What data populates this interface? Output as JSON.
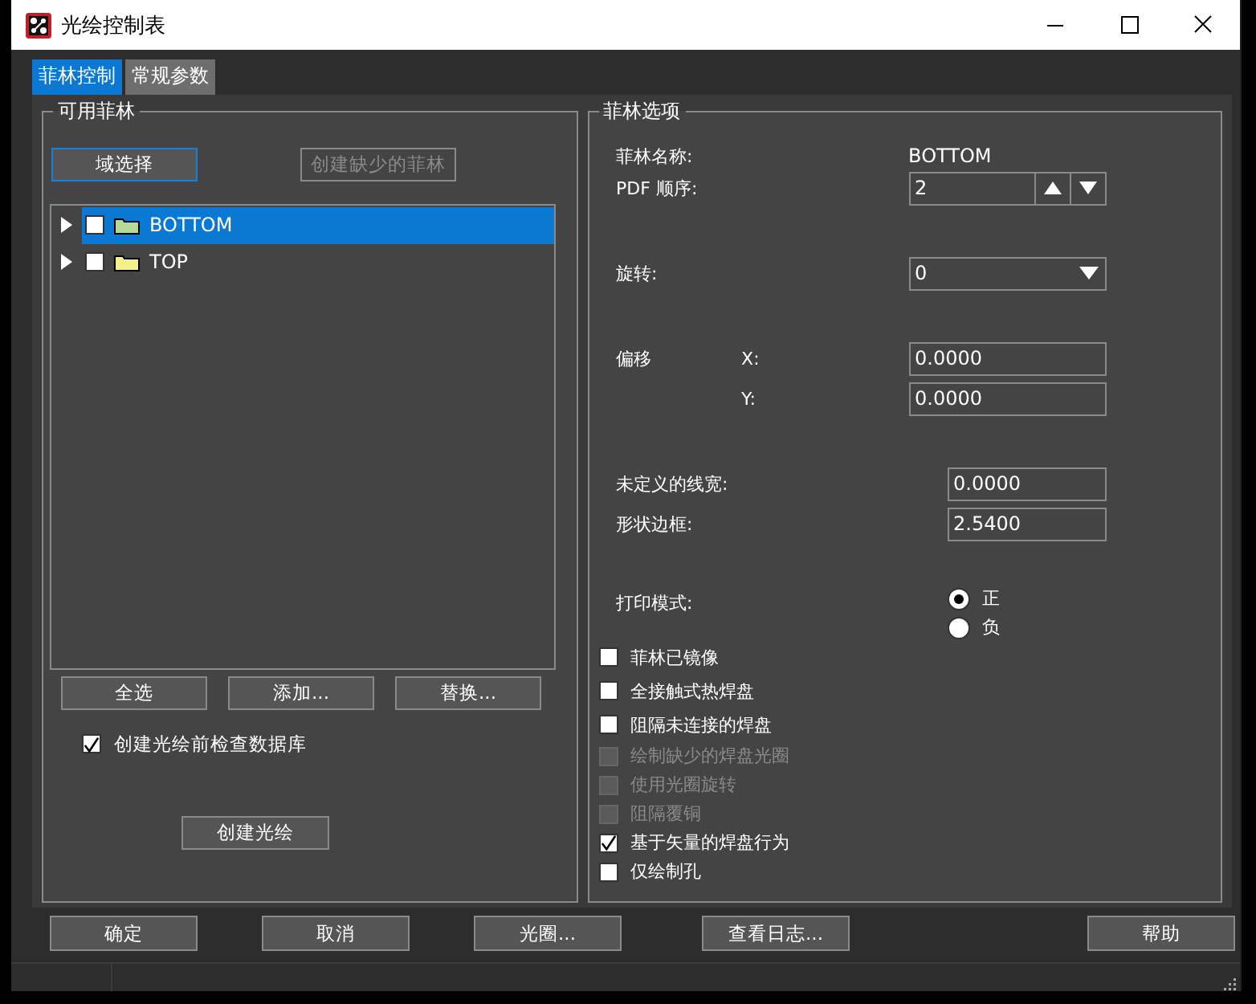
{
  "window": {
    "title": "光绘控制表"
  },
  "tabs": [
    {
      "label": "菲林控制",
      "selected": true
    },
    {
      "label": "常规参数",
      "selected": false
    }
  ],
  "layers_group": {
    "title": "可用菲林",
    "top_buttons": [
      {
        "label": "域选择",
        "disabled": false,
        "focused": true
      },
      {
        "label": "创建缺少的菲林",
        "disabled": true,
        "focused": false
      }
    ],
    "tree": [
      {
        "name": "BOTTOM",
        "checked": false,
        "selected": true,
        "color": "#b5d99a"
      },
      {
        "name": "TOP",
        "checked": false,
        "selected": false,
        "color": "#f4f08a"
      }
    ],
    "buttons": [
      "全选",
      "添加...",
      "替换..."
    ],
    "check_db": {
      "label": "创建光绘前检查数据库",
      "checked": true
    },
    "create_button": "创建光绘"
  },
  "options_group": {
    "title": "菲林选项",
    "name_label": "菲林名称:",
    "name_value": "BOTTOM",
    "pdf_order_label": "PDF 顺序:",
    "pdf_order_value": "2",
    "rotation_label": "旋转:",
    "rotation_value": "0",
    "offset_label": "偏移",
    "x_label": "X:",
    "x_value": "0.0000",
    "y_label": "Y:",
    "y_value": "0.0000",
    "line_width_label": "未定义的线宽:",
    "line_width_value": "0.0000",
    "border_label": "形状边框:",
    "border_value": "2.5400",
    "print_mode_label": "打印模式:",
    "print_modes": [
      {
        "label": "正",
        "selected": true
      },
      {
        "label": "负",
        "selected": false
      }
    ],
    "checkboxes": [
      {
        "label": "菲林已镜像",
        "checked": false,
        "disabled": false
      },
      {
        "label": "全接触式热焊盘",
        "checked": false,
        "disabled": false
      },
      {
        "label": "阻隔未连接的焊盘",
        "checked": false,
        "disabled": false
      },
      {
        "label": "绘制缺少的焊盘光圈",
        "checked": false,
        "disabled": true
      },
      {
        "label": "使用光圈旋转",
        "checked": false,
        "disabled": true
      },
      {
        "label": "阻隔覆铜",
        "checked": false,
        "disabled": true
      },
      {
        "label": "基于矢量的焊盘行为",
        "checked": true,
        "disabled": false
      },
      {
        "label": "仅绘制孔",
        "checked": false,
        "disabled": false
      }
    ]
  },
  "footer_buttons": [
    "确定",
    "取消",
    "光圈...",
    "查看日志...",
    "帮助"
  ]
}
